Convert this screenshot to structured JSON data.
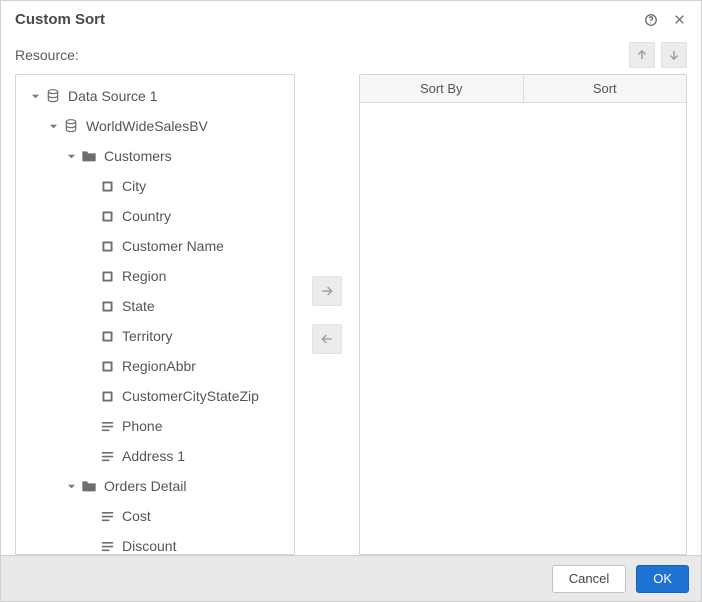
{
  "dialog": {
    "title": "Custom Sort",
    "resource_label": "Resource:"
  },
  "tree": {
    "root": {
      "label": "Data Source 1",
      "children": [
        {
          "label": "WorldWideSalesBV",
          "children": [
            {
              "label": "Customers",
              "fields": [
                {
                  "label": "City",
                  "kind": "dim"
                },
                {
                  "label": "Country",
                  "kind": "dim"
                },
                {
                  "label": "Customer Name",
                  "kind": "dim"
                },
                {
                  "label": "Region",
                  "kind": "dim"
                },
                {
                  "label": "State",
                  "kind": "dim"
                },
                {
                  "label": "Territory",
                  "kind": "dim"
                },
                {
                  "label": "RegionAbbr",
                  "kind": "dim"
                },
                {
                  "label": "CustomerCityStateZip",
                  "kind": "dim"
                },
                {
                  "label": "Phone",
                  "kind": "text"
                },
                {
                  "label": "Address 1",
                  "kind": "text"
                }
              ]
            },
            {
              "label": "Orders Detail",
              "fields": [
                {
                  "label": "Cost",
                  "kind": "text"
                },
                {
                  "label": "Discount",
                  "kind": "text"
                }
              ]
            }
          ]
        }
      ]
    }
  },
  "table": {
    "columns": [
      "Sort By",
      "Sort"
    ]
  },
  "buttons": {
    "cancel": "Cancel",
    "ok": "OK"
  }
}
